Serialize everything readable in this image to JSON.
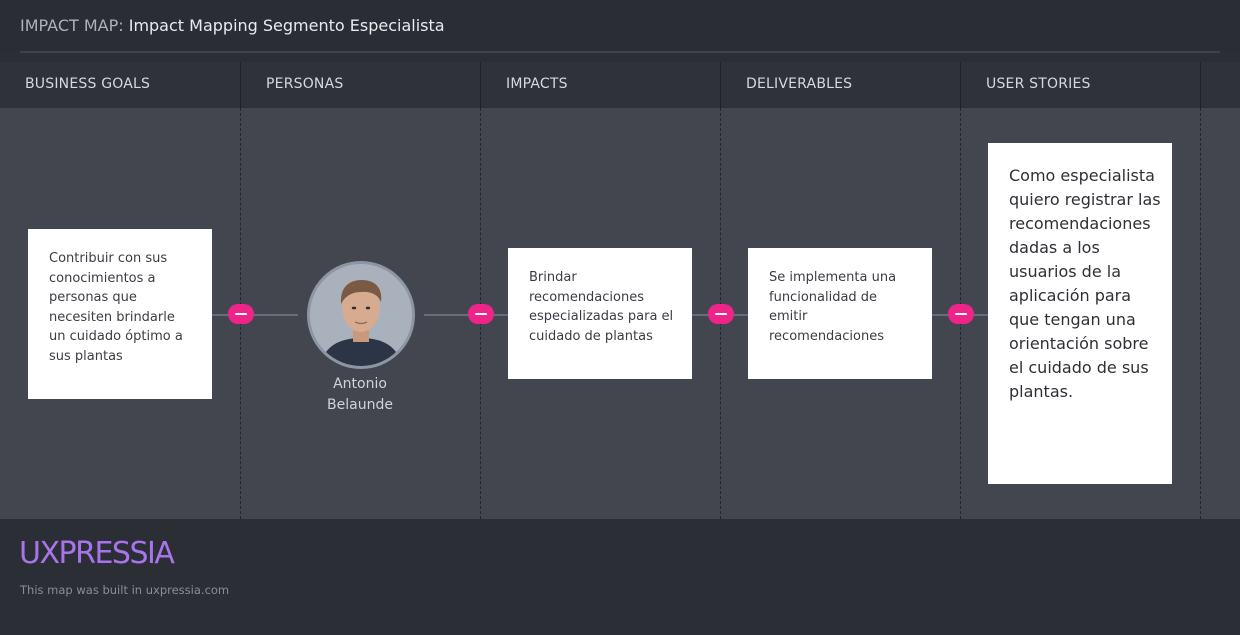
{
  "map": {
    "title_prefix": "IMPACT MAP: ",
    "title": "Impact Mapping Segmento Especialista"
  },
  "columns": [
    "BUSINESS GOALS",
    "PERSONAS",
    "IMPACTS",
    "DELIVERABLES",
    "USER STORIES"
  ],
  "goal": {
    "text": "Contribuir con sus conocimientos a personas que necesiten brindarle un cuidado óptimo a sus plantas"
  },
  "persona": {
    "first_name": "Antonio",
    "last_name": "Belaunde",
    "icon": "user-avatar-photo"
  },
  "impact": {
    "text": "Brindar recomendaciones especializadas para el cuidado de plantas"
  },
  "deliverable": {
    "text": "Se implementa una funcionalidad de emitir recomendaciones"
  },
  "user_story": {
    "text": "Como especialista quiero registrar las recomendaciones dadas a los usuarios de la aplicación para que tengan una orientación sobre el cuidado de sus plantas."
  },
  "link_icon": "minus-icon",
  "colors": {
    "accent_pink": "#f0238a",
    "logo_purple": "#a774ec",
    "canvas": "#43464f",
    "header": "#30323b"
  },
  "footer": {
    "logo": "UXPRESSIA",
    "built_text": "This map was built in uxpressia.com"
  }
}
